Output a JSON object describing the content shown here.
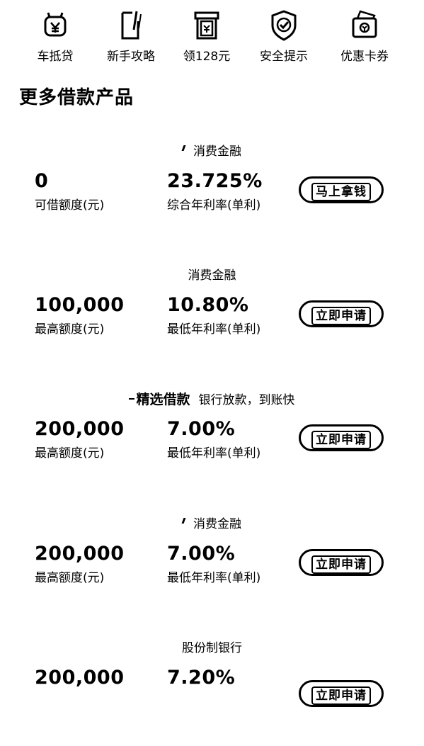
{
  "shortcuts": [
    {
      "label": "车抵贷",
      "icon": "car-loan-icon"
    },
    {
      "label": "新手攻略",
      "icon": "guide-icon"
    },
    {
      "label": "领128元",
      "icon": "gift-icon"
    },
    {
      "label": "安全提示",
      "icon": "shield-icon"
    },
    {
      "label": "优惠卡券",
      "icon": "coupon-icon"
    }
  ],
  "section_title": "更多借款产品",
  "products": [
    {
      "tag": "消费金融",
      "tag_strong": "",
      "amount": "0",
      "amount_label": "可借额度(元)",
      "rate": "23.725%",
      "rate_label": "综合年利率(单利)",
      "button": "马上拿钱"
    },
    {
      "tag": "消费金融",
      "tag_strong": "",
      "amount": "100,000",
      "amount_label": "最高额度(元)",
      "rate": "10.80%",
      "rate_label": "最低年利率(单利)",
      "button": "立即申请"
    },
    {
      "tag": "银行放款，到账快",
      "tag_strong": "精选借款",
      "amount": "200,000",
      "amount_label": "最高额度(元)",
      "rate": "7.00%",
      "rate_label": "最低年利率(单利)",
      "button": "立即申请"
    },
    {
      "tag": "消费金融",
      "tag_strong": "",
      "amount": "200,000",
      "amount_label": "最高额度(元)",
      "rate": "7.00%",
      "rate_label": "最低年利率(单利)",
      "button": "立即申请"
    },
    {
      "tag": "股份制银行",
      "tag_strong": "",
      "amount": "200,000",
      "amount_label": "",
      "rate": "7.20%",
      "rate_label": "",
      "button": "立即申请"
    }
  ]
}
